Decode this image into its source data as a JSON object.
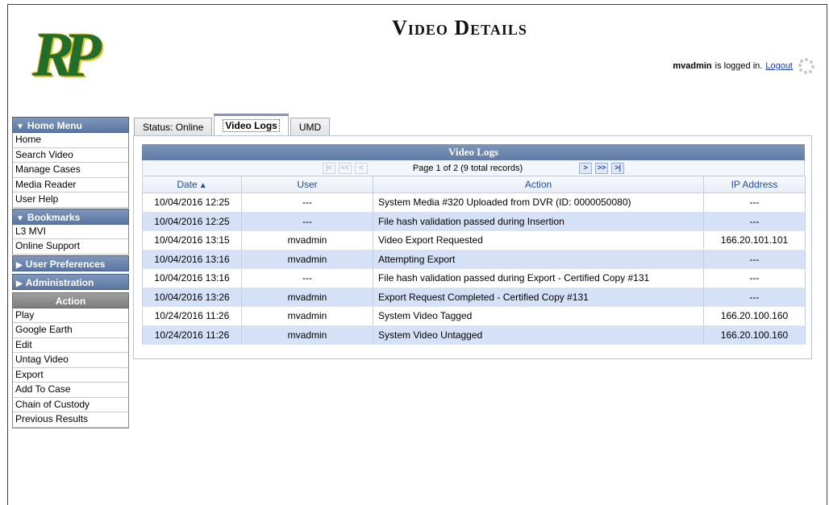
{
  "logo": {
    "text": "RP"
  },
  "page_title": "Video Details",
  "login": {
    "username": "mvadmin",
    "status_text": "is logged in.",
    "logout_label": "Logout"
  },
  "sidebar": {
    "home_menu": {
      "label": "Home Menu",
      "items": [
        "Home",
        "Search Video",
        "Manage Cases",
        "Media Reader",
        "User Help"
      ]
    },
    "bookmarks": {
      "label": "Bookmarks",
      "items": [
        "L3 MVI",
        "Online Support"
      ]
    },
    "user_preferences": {
      "label": "User Preferences"
    },
    "administration": {
      "label": "Administration"
    },
    "action": {
      "label": "Action",
      "items": [
        "Play",
        "Google Earth",
        "Edit",
        "Untag Video",
        "Export",
        "Add To Case",
        "Chain of Custody",
        "Previous Results"
      ]
    }
  },
  "tabs": [
    {
      "label": "Status: Online",
      "active": false
    },
    {
      "label": "Video Logs",
      "active": true
    },
    {
      "label": "UMD",
      "active": false
    }
  ],
  "grid": {
    "title": "Video Logs",
    "pager": {
      "text": "Page 1 of 2 (9 total records)",
      "first": "|<",
      "prev_page": "<<",
      "prev": "<",
      "next": ">",
      "next_page": ">>",
      "last": ">|"
    },
    "columns": {
      "date": "Date",
      "user": "User",
      "action": "Action",
      "ip": "IP Address"
    },
    "sort_indicator": "▲",
    "rows": [
      {
        "date": "10/04/2016 12:25",
        "user": "---",
        "action": "System Media #320 Uploaded from DVR (ID: 0000050080)",
        "ip": "---"
      },
      {
        "date": "10/04/2016 12:25",
        "user": "---",
        "action": "File hash validation passed during Insertion",
        "ip": "---"
      },
      {
        "date": "10/04/2016 13:15",
        "user": "mvadmin",
        "action": "Video Export Requested",
        "ip": "166.20.101.101"
      },
      {
        "date": "10/04/2016 13:16",
        "user": "mvadmin",
        "action": "Attempting Export",
        "ip": "---"
      },
      {
        "date": "10/04/2016 13:16",
        "user": "---",
        "action": "File hash validation passed during Export - Certified Copy #131",
        "ip": "---"
      },
      {
        "date": "10/04/2016 13:26",
        "user": "mvadmin",
        "action": "Export Request Completed - Certified Copy #131",
        "ip": "---"
      },
      {
        "date": "10/24/2016 11:26",
        "user": "mvadmin",
        "action": "System Video Tagged",
        "ip": "166.20.100.160"
      },
      {
        "date": "10/24/2016 11:26",
        "user": "mvadmin",
        "action": "System Video Untagged",
        "ip": "166.20.100.160"
      }
    ]
  }
}
